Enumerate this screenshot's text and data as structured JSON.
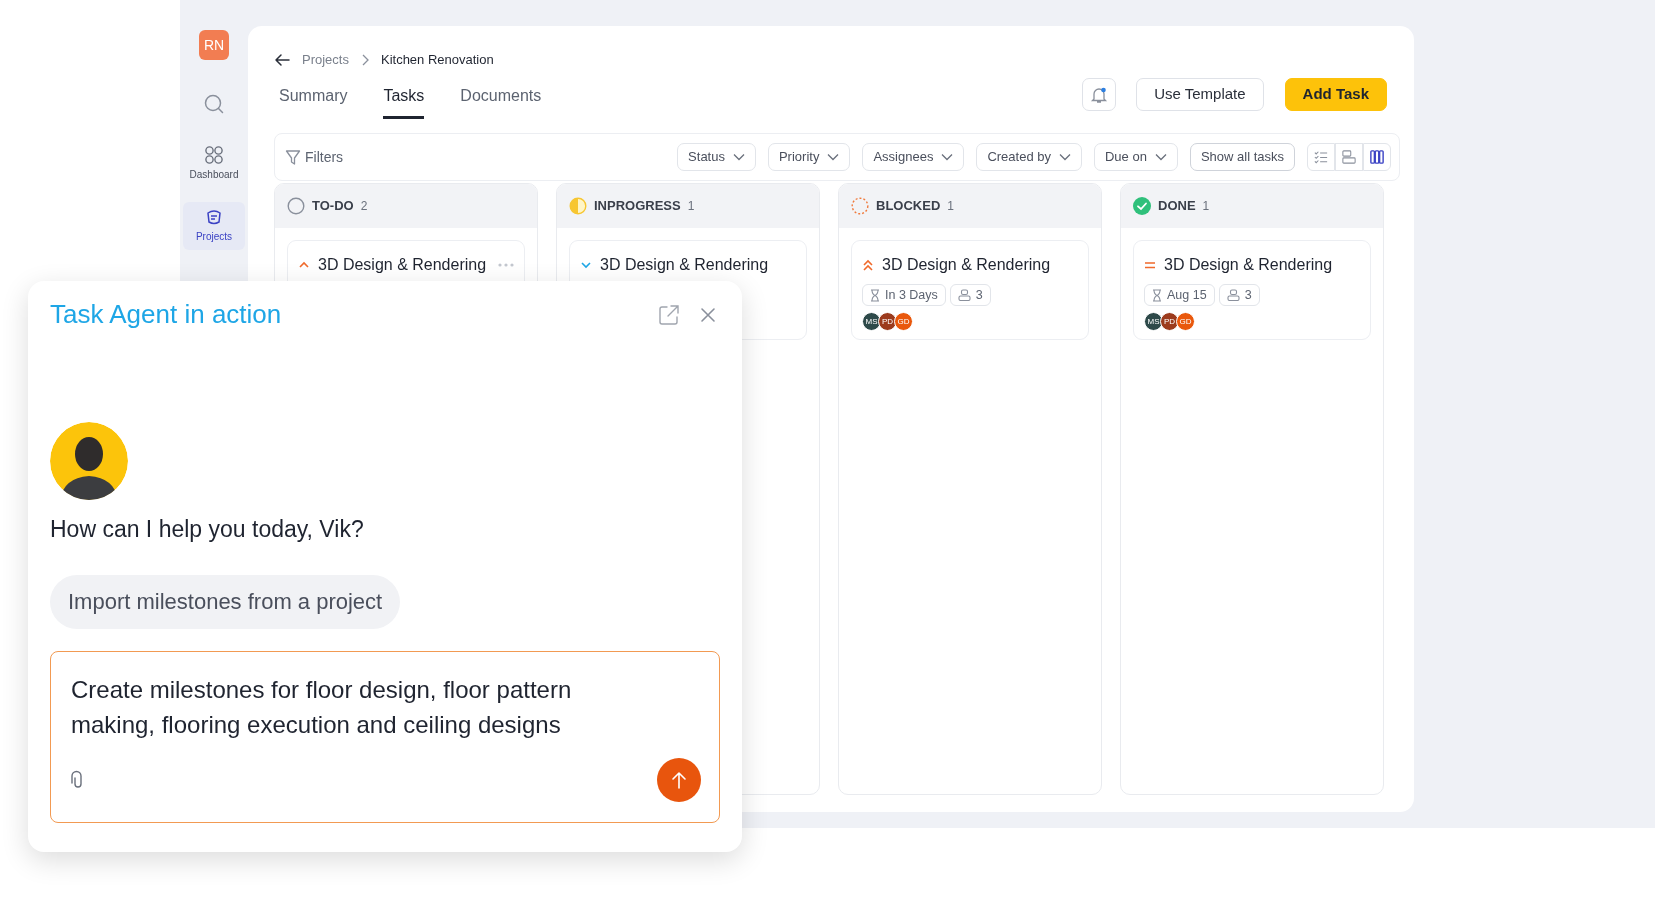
{
  "sidebar": {
    "avatar_initials": "RN",
    "items": [
      {
        "kind": "dashboard",
        "label": "Dashboard",
        "selected": false
      },
      {
        "kind": "projects",
        "label": "Projects",
        "selected": true
      }
    ]
  },
  "breadcrumb": [
    "Projects",
    "Kitchen Renovation"
  ],
  "tabs": [
    {
      "label": "Summary",
      "selected": false
    },
    {
      "label": "Tasks",
      "selected": true
    },
    {
      "label": "Documents",
      "selected": false
    }
  ],
  "header_buttons": [
    {
      "kind": "secondary",
      "label": "Use Template"
    },
    {
      "kind": "primary",
      "label": "Add Task"
    }
  ],
  "filters": {
    "label": "Filters",
    "dropdowns": [
      "Status",
      "Priority",
      "Assignees",
      "Created by",
      "Due on"
    ],
    "show_all": "Show all tasks",
    "views": [
      {
        "kind": "list",
        "selected": false
      },
      {
        "kind": "rows",
        "selected": false
      },
      {
        "kind": "board",
        "selected": true
      }
    ]
  },
  "columns": [
    {
      "kind": "todo",
      "title": "TO-DO",
      "count": "2",
      "cards": [
        {
          "title": "3D Design & Rendering",
          "kind": "high",
          "more": true
        }
      ]
    },
    {
      "kind": "inprogress",
      "title": "INPROGRESS",
      "count": "1",
      "cards": [
        {
          "title": "3D Design & Rendering",
          "kind": "low",
          "more": false
        }
      ]
    },
    {
      "kind": "blocked",
      "title": "BLOCKED",
      "count": "1",
      "cards": [
        {
          "title": "3D Design & Rendering",
          "kind": "urgent",
          "more": false,
          "due": "In 3 Days",
          "assignee_count": "3",
          "avatars": [
            {
              "initials": "MS",
              "color": "#2e4a4a"
            },
            {
              "initials": "PD",
              "color": "#9c3b1d"
            },
            {
              "initials": "GD",
              "color": "#e9580c"
            }
          ]
        }
      ]
    },
    {
      "kind": "done",
      "title": "DONE",
      "count": "1",
      "cards": [
        {
          "title": "3D Design & Rendering",
          "kind": "medium",
          "more": false,
          "due": "Aug 15",
          "assignee_count": "3",
          "avatars": [
            {
              "initials": "MS",
              "color": "#2e4a4a"
            },
            {
              "initials": "PD",
              "color": "#9c3b1d"
            },
            {
              "initials": "GD",
              "color": "#e9580c"
            }
          ]
        }
      ]
    }
  ],
  "chat": {
    "title": "Task Agent in action",
    "greeting": "How can I help you today, Vik?",
    "suggestion": "Import milestones from a project",
    "message": "Create milestones for floor design, floor pattern making, flooring execution and ceiling designs"
  }
}
